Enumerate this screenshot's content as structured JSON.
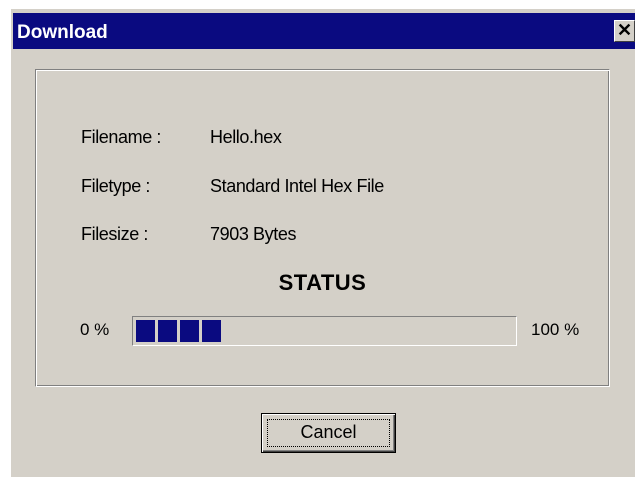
{
  "window": {
    "title": "Download",
    "close_glyph": "✕"
  },
  "info": {
    "filename_label": "Filename :",
    "filename_value": "Hello.hex",
    "filetype_label": "Filetype :",
    "filetype_value": "Standard Intel Hex File",
    "filesize_label": "Filesize :",
    "filesize_value": "7903 Bytes"
  },
  "status": {
    "title": "STATUS",
    "min_label": "0 %",
    "max_label": "100 %",
    "progress_blocks_filled": 4,
    "progress_fraction": 0.25
  },
  "buttons": {
    "cancel_label": "Cancel"
  },
  "colors": {
    "titlebar": "#0a0a80",
    "progress_fill": "#0a0a80",
    "dialog_face": "#d4d0c8"
  }
}
